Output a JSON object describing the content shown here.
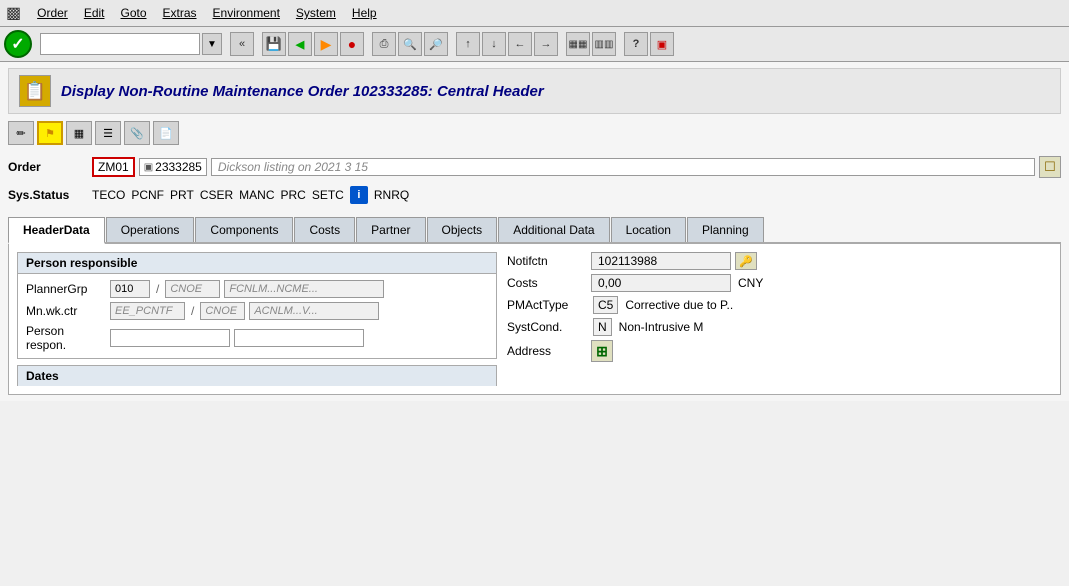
{
  "menubar": {
    "app_icon": "☰",
    "items": [
      "Order",
      "Edit",
      "Goto",
      "Extras",
      "Environment",
      "System",
      "Help"
    ]
  },
  "toolbar": {
    "input_placeholder": "",
    "chevron_left": "«",
    "save_icon": "💾",
    "back_icon": "◀",
    "forward_icon": "▶",
    "cancel_icon": "✖",
    "print_icon": "🖨",
    "find_icon": "🔍",
    "help_icon": "?",
    "monitor_icon": "🖥"
  },
  "title": {
    "text": "Display Non-Routine Maintenance Order 102333285: Central Header"
  },
  "order": {
    "label": "Order",
    "type": "ZM01",
    "number": "2333285",
    "description": "Dickson  listing on 2021 3 15",
    "status_label": "Sys.Status",
    "statuses": [
      "TECO",
      "PCNF",
      "PRT",
      "CSER",
      "MANC",
      "PRC",
      "SETC",
      "RNRQ"
    ]
  },
  "tabs": [
    {
      "id": "headerdata",
      "label": "HeaderData",
      "active": true
    },
    {
      "id": "operations",
      "label": "Operations",
      "active": false
    },
    {
      "id": "components",
      "label": "Components",
      "active": false
    },
    {
      "id": "costs",
      "label": "Costs",
      "active": false
    },
    {
      "id": "partner",
      "label": "Partner",
      "active": false
    },
    {
      "id": "objects",
      "label": "Objects",
      "active": false
    },
    {
      "id": "additional_data",
      "label": "Additional Data",
      "active": false
    },
    {
      "id": "location",
      "label": "Location",
      "active": false
    },
    {
      "id": "planning",
      "label": "Planning",
      "active": false
    }
  ],
  "person_responsible": {
    "section_title": "Person responsible",
    "planner_grp_label": "PlannerGrp",
    "planner_grp_value": "010",
    "planner_grp_slash": "/",
    "planner_grp_code": "CNOE",
    "planner_grp_desc": "FCNLM...NCME...",
    "mn_wk_ctr_label": "Mn.wk.ctr",
    "mn_wk_ctr_code1": "EE_PCNTF",
    "mn_wk_ctr_slash": "/",
    "mn_wk_ctr_code2": "CNOE",
    "mn_wk_ctr_desc": "ACNLM...V...",
    "person_respon_label": "Person respon."
  },
  "right_panel": {
    "notifctn_label": "Notifctn",
    "notifctn_value": "102113988",
    "costs_label": "Costs",
    "costs_value": "0,00",
    "costs_unit": "CNY",
    "pmacttype_label": "PMActType",
    "pmacttype_code": "C5",
    "pmacttype_desc": "Corrective due to P..",
    "systcond_label": "SystCond.",
    "systcond_code": "N",
    "systcond_desc": "Non-Intrusive M",
    "address_label": "Address"
  },
  "dates": {
    "section_title": "Dates"
  },
  "icons": {
    "checkmark": "✓",
    "chevrons": "«",
    "save": "▣",
    "back_green": "◀",
    "forward_orange": "◀",
    "stop_red": "⬟",
    "printer": "⎙",
    "binoculars1": "⊞",
    "binoculars2": "⊟",
    "arrow1": "↑",
    "arrow2": "↓",
    "arrow3": "←",
    "arrow4": "→",
    "screen1": "▦",
    "screen2": "▥",
    "question": "?",
    "monitor": "▣",
    "key": "🔑",
    "plus": "⊕",
    "info": "i",
    "small_arrow": "▼",
    "page_icon": "📄",
    "box_icon": "⊞"
  }
}
